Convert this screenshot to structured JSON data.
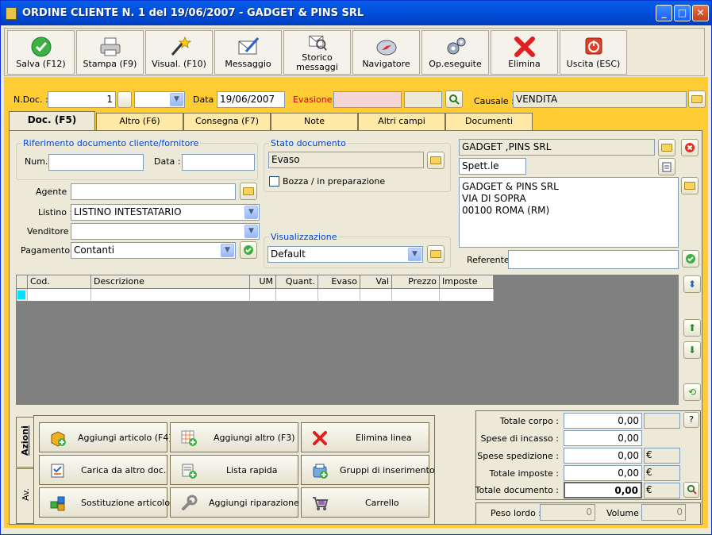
{
  "window": {
    "title": "ORDINE CLIENTE N. 1  del 19/06/2007 - GADGET & PINS SRL",
    "min": "_",
    "max": "□",
    "close": "✕"
  },
  "toolbar": [
    {
      "label": "Salva (F12)",
      "icon": "check-save-icon"
    },
    {
      "label": "Stampa (F9)",
      "icon": "printer-icon"
    },
    {
      "label": "Visual. (F10)",
      "icon": "magic-wand-icon"
    },
    {
      "label": "Messaggio",
      "icon": "message-pen-icon"
    },
    {
      "label": "Storico messaggi",
      "icon": "message-history-icon"
    },
    {
      "label": "Navigatore",
      "icon": "compass-icon"
    },
    {
      "label": "Op.eseguite",
      "icon": "gears-icon"
    },
    {
      "label": "Elimina",
      "icon": "red-x-icon"
    },
    {
      "label": "Uscita (ESC)",
      "icon": "power-exit-icon"
    }
  ],
  "header": {
    "ndoc_label": "N.Doc. :",
    "ndoc_value": "1",
    "data_label": "Data :",
    "data_value": "19/06/2007",
    "evasione_label": "Evasione:",
    "evasione_value": "",
    "causale_label": "Causale :",
    "causale_value": "VENDITA"
  },
  "tabs": [
    "Doc. (F5)",
    "Altro (F6)",
    "Consegna (F7)",
    "Note",
    "Altri campi",
    "Documenti"
  ],
  "riferimento": {
    "title": "Riferimento documento cliente/fornitore",
    "num_label": "Num.:",
    "num_value": "",
    "data_label": "Data :",
    "data_value": ""
  },
  "stato": {
    "title": "Stato documento",
    "value": "Evaso",
    "bozza_label": "Bozza / in preparazione",
    "bozza_checked": false
  },
  "fields": {
    "agente_label": "Agente :",
    "agente_value": "",
    "listino_label": "Listino :",
    "listino_value": "LISTINO INTESTATARIO",
    "venditore_label": "Venditore :",
    "venditore_value": "",
    "pagamento_label": "Pagamento :",
    "pagamento_value": "Contanti"
  },
  "visualizzazione": {
    "title": "Visualizzazione",
    "value": "Default"
  },
  "cliente": {
    "name": "GADGET ,PINS SRL",
    "salutation": "Spett.le",
    "address_lines": [
      "GADGET & PINS SRL",
      "VIA DI SOPRA",
      "00100 ROMA (RM)"
    ],
    "referente_label": "Referente",
    "referente_value": ""
  },
  "grid": {
    "columns": [
      "Cod.",
      "Descrizione",
      "UM",
      "Quant.",
      "Evaso",
      "Val",
      "Prezzo",
      "Imposte"
    ]
  },
  "side_tabs": [
    "Azioni",
    "Av."
  ],
  "actions": [
    {
      "label": "Aggiungi articolo (F4)",
      "icon": "add-article-icon"
    },
    {
      "label": "Aggiungi altro (F3)",
      "icon": "add-other-icon"
    },
    {
      "label": "Elimina linea",
      "icon": "delete-line-icon"
    },
    {
      "label": "Carica da altro doc.",
      "icon": "load-doc-icon"
    },
    {
      "label": "Lista rapida",
      "icon": "quick-list-icon"
    },
    {
      "label": "Gruppi di inserimento",
      "icon": "insert-groups-icon"
    },
    {
      "label": "Sostituzione articolo",
      "icon": "replace-article-icon"
    },
    {
      "label": "Aggiungi riparazione",
      "icon": "wrench-icon"
    },
    {
      "label": "Carrello",
      "icon": "cart-icon"
    }
  ],
  "totals": {
    "corpo_label": "Totale corpo :",
    "corpo_value": "0,00",
    "help": "?",
    "incasso_label": "Spese di incasso :",
    "incasso_value": "0,00",
    "spedizione_label": "Spese spedizione :",
    "spedizione_value": "0,00",
    "imposte_label": "Totale imposte :",
    "imposte_value": "0,00",
    "documento_label": "Totale documento :",
    "documento_value": "0,00",
    "currency": "€",
    "peso_label": "Peso lordo :",
    "peso_value": "0",
    "volume_label": "Volume :",
    "volume_value": "0"
  }
}
